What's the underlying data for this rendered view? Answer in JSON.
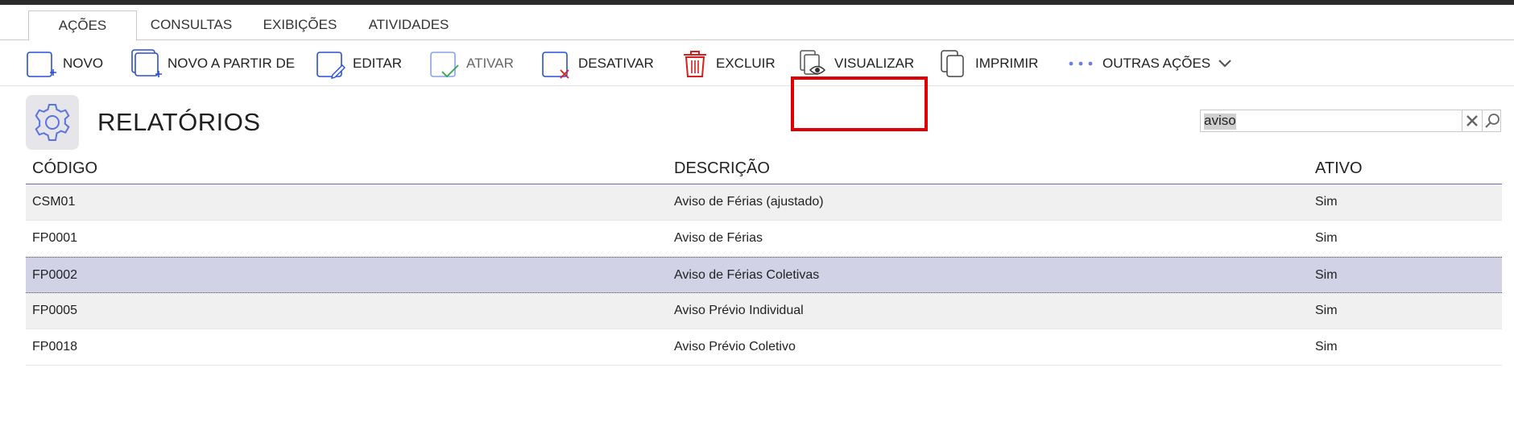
{
  "tabs": [
    {
      "label": "AÇÕES",
      "active": true
    },
    {
      "label": "CONSULTAS",
      "active": false
    },
    {
      "label": "EXIBIÇÕES",
      "active": false
    },
    {
      "label": "ATIVIDADES",
      "active": false
    }
  ],
  "toolbar": {
    "novo": {
      "label": "NOVO",
      "icon": "new-document-icon"
    },
    "novo_partir": {
      "label": "NOVO A PARTIR DE",
      "icon": "copy-new-icon"
    },
    "editar": {
      "label": "EDITAR",
      "icon": "edit-icon"
    },
    "ativar": {
      "label": "ATIVAR",
      "icon": "activate-icon",
      "disabled": true
    },
    "desativar": {
      "label": "DESATIVAR",
      "icon": "deactivate-icon"
    },
    "excluir": {
      "label": "EXCLUIR",
      "icon": "trash-icon"
    },
    "visualizar": {
      "label": "VISUALIZAR",
      "icon": "view-icon",
      "highlighted": true
    },
    "imprimir": {
      "label": "IMPRIMIR",
      "icon": "print-icon"
    },
    "outras": {
      "label": "OUTRAS AÇÕES",
      "icon": "chevron-down-icon"
    }
  },
  "page": {
    "title": "RELATÓRIOS",
    "icon": "gear-icon"
  },
  "search": {
    "value": "aviso",
    "placeholder": ""
  },
  "table": {
    "headers": {
      "codigo": "CÓDIGO",
      "descricao": "DESCRIÇÃO",
      "ativo": "ATIVO"
    },
    "rows": [
      {
        "codigo": "CSM01",
        "descricao": "Aviso de Férias (ajustado)",
        "ativo": "Sim"
      },
      {
        "codigo": "FP0001",
        "descricao": "Aviso de Férias",
        "ativo": "Sim"
      },
      {
        "codigo": "FP0002",
        "descricao": "Aviso de Férias Coletivas",
        "ativo": "Sim",
        "selected": true
      },
      {
        "codigo": "FP0005",
        "descricao": "Aviso Prévio Individual",
        "ativo": "Sim"
      },
      {
        "codigo": "FP0018",
        "descricao": "Aviso Prévio Coletivo",
        "ativo": "Sim"
      }
    ]
  },
  "colors": {
    "accent": "#2a4fd6",
    "selected_row": "#d1d2e6",
    "highlight_border": "#e00000",
    "delete_red": "#d62020",
    "activate_green": "#2da84a"
  }
}
